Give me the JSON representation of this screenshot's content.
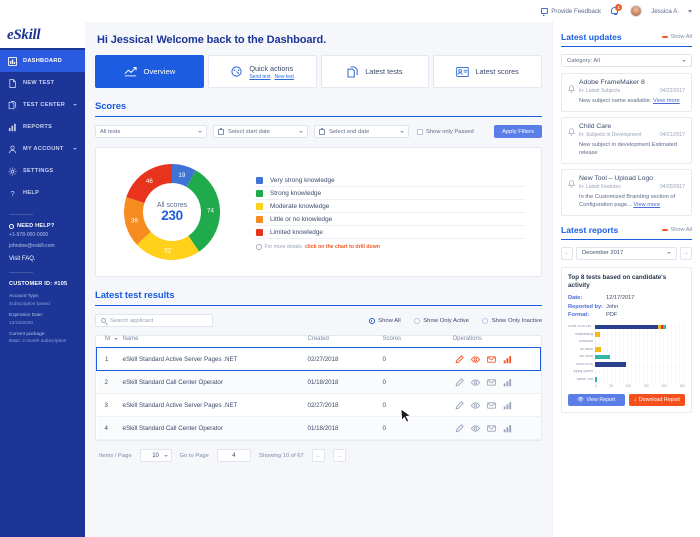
{
  "topbar": {
    "feedback_label": "Provide Feedback",
    "notification_count": "1",
    "username": "Jessica A."
  },
  "sidebar": {
    "logo": "eSkill",
    "items": [
      {
        "label": "DASHBOARD",
        "icon": "dashboard-icon",
        "active": true,
        "expandable": false
      },
      {
        "label": "NEW TEST",
        "icon": "file-icon",
        "active": false,
        "expandable": false
      },
      {
        "label": "TEST CENTER",
        "icon": "files-icon",
        "active": false,
        "expandable": true
      },
      {
        "label": "REPORTS",
        "icon": "bar-chart-icon",
        "active": false,
        "expandable": false
      },
      {
        "label": "MY ACCOUNT",
        "icon": "user-icon",
        "active": false,
        "expandable": true
      },
      {
        "label": "SETTINGS",
        "icon": "gear-icon",
        "active": false,
        "expandable": false
      },
      {
        "label": "HELP",
        "icon": "question-icon",
        "active": false,
        "expandable": false
      }
    ],
    "help": {
      "title": "NEED HELP?",
      "phone": "+1-978-000-0000",
      "email": "johndoe@eskill.com",
      "faq_link": "Visit FAQ."
    },
    "customer": {
      "id_label": "CUSTOMER ID: #105",
      "account_type_key": "Account Type:",
      "account_type_value": "Subscription based",
      "expiration_key": "Expiration Date:",
      "expiration_value": "12/15/2030",
      "package_key": "Current package:",
      "package_value": "Basic 3 month subscription"
    }
  },
  "main": {
    "greeting": "Hi Jessica! Welcome back to the Dashboard.",
    "tabs": [
      {
        "label": "Overview",
        "icon": "trend-line-icon",
        "active": true,
        "sublinks": []
      },
      {
        "label": "Quick actions",
        "icon": "speedometer-icon",
        "active": false,
        "sublinks": [
          "Send test",
          "New test"
        ]
      },
      {
        "label": "Latest tests",
        "icon": "documents-icon",
        "active": false,
        "sublinks": []
      },
      {
        "label": "Latest scores",
        "icon": "id-card-icon",
        "active": false,
        "sublinks": []
      }
    ],
    "scores": {
      "title": "Scores",
      "filters": {
        "test_select": "All tests",
        "start_date": "Select start date",
        "end_date": "Select end date",
        "passed_checkbox": "Show only Passed",
        "apply_button": "Apply Filters"
      },
      "hint_prefix": "For more details",
      "hint_link": "click on the chart to drill down"
    },
    "results": {
      "title": "Latest test results",
      "search_placeholder": "Search applicant",
      "radios": [
        {
          "label": "Show All",
          "selected": true
        },
        {
          "label": "Show Only Active",
          "selected": false
        },
        {
          "label": "Show Only Inactive",
          "selected": false
        }
      ],
      "columns": [
        "Nr",
        "Name",
        "Created",
        "Scores",
        "Operations"
      ],
      "rows": [
        {
          "nr": "1",
          "name": "eSkill Standard Active Server Pages .NET",
          "created": "02/27/2018",
          "scores": "0",
          "hover": true
        },
        {
          "nr": "2",
          "name": "eSkill Standard Call Center Operator",
          "created": "01/18/2018",
          "scores": "0",
          "hover": false
        },
        {
          "nr": "3",
          "name": "eSkill Standard Active Server Pages .NET",
          "created": "02/27/2018",
          "scores": "0",
          "hover": false
        },
        {
          "nr": "4",
          "name": "eSkill Standard Call Center Operator",
          "created": "01/18/2018",
          "scores": "0",
          "hover": false
        }
      ],
      "operations_icons": [
        "edit-icon",
        "eye-icon",
        "mail-icon",
        "chart-icon"
      ],
      "pager": {
        "items_label": "Items / Page",
        "items_value": "10",
        "goto_label": "Go to Page",
        "goto_value": "4",
        "showing": "Showing 10 of 67",
        "prev": "←",
        "next": "→"
      }
    }
  },
  "rail": {
    "updates": {
      "title": "Latest updates",
      "show_all": "Show All",
      "category_select": "Category: All",
      "items": [
        {
          "name": "Adobe FrameMaker 8",
          "in": "In: Latest Subjects",
          "date": "04/22/2017",
          "body": "New subject name available.",
          "link": "View more"
        },
        {
          "name": "Child Care",
          "in": "In: Subjects in Development",
          "date": "04/21/2017",
          "body": "New subject in development.Estimated release",
          "link": ""
        },
        {
          "name": "New Tool – Upload Logo",
          "in": "In: Latest Features",
          "date": "04/20/2017",
          "body": "In the Customized Branding section of Configuration page...",
          "link": "View more"
        }
      ]
    },
    "reports": {
      "title": "Latest reports",
      "show_all": "Show All",
      "month": "December 2017",
      "card_title": "Top 8 tests based on candidate's activity",
      "date_key": "Date:",
      "date_value": "12/17/2017",
      "reported_key": "Reported by:",
      "reported_value": "John",
      "format_key": "Format:",
      "format_value": "PDF",
      "view_button": "View Report",
      "download_button": "Download Report"
    }
  },
  "chart_data": [
    {
      "type": "pie",
      "title": "All scores",
      "center_label": "All scores",
      "center_value": "230",
      "total": 230,
      "labels": [
        "Very strong knowledge",
        "Strong knowledge",
        "Moderate knowledge",
        "Little or no knowledge",
        "Limited knowledge"
      ],
      "values": [
        19,
        74,
        52,
        39,
        46
      ],
      "colors": [
        "#3f74d6",
        "#1faa4b",
        "#ffd11a",
        "#f68b1f",
        "#e8341c"
      ],
      "legend_position": "right",
      "donut": true
    },
    {
      "type": "bar",
      "orientation": "horizontal",
      "title": "Top 8 tests based on candidate's activity",
      "categories": [
        "Excel 2016 Lev...",
        "Multitasking",
        "Grammar",
        "All users",
        "Ms Word",
        "Excel 2016",
        "Typing Speed",
        "Name Test"
      ],
      "values": [
        198,
        14,
        2,
        18,
        42,
        85,
        3,
        6
      ],
      "colors": [
        "#2b3f8f",
        "#f5b618",
        "#e9edf5",
        "#f5b618",
        "#35b5a8",
        "#2b3f8f",
        "#e9edf5",
        "#35b5a8"
      ],
      "xlabel": "",
      "ylabel": "",
      "xlim": [
        0,
        250
      ],
      "xticks": [
        "0",
        "50",
        "100",
        "150",
        "200",
        "250"
      ],
      "grid": true
    }
  ]
}
